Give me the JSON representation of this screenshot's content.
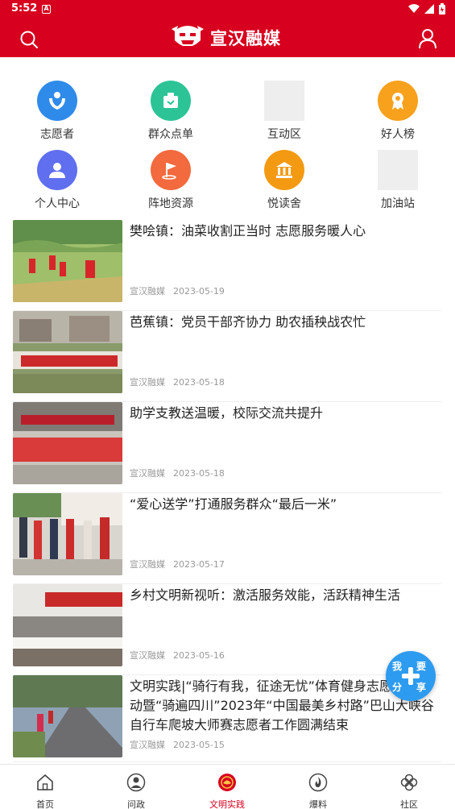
{
  "status": {
    "time": "5:52",
    "notif_glyph": "A"
  },
  "header": {
    "title": "宣汉融媒",
    "accent": "#d8001f"
  },
  "grid": [
    {
      "label": "志愿者",
      "icon": "volunteer-icon",
      "color": "#2f8bea"
    },
    {
      "label": "群众点单",
      "icon": "order-icon",
      "color": "#2cc497"
    },
    {
      "label": "互动区",
      "icon": "image-placeholder",
      "color": ""
    },
    {
      "label": "好人榜",
      "icon": "award-icon",
      "color": "#f7a11c"
    },
    {
      "label": "个人中心",
      "icon": "user-center-icon",
      "color": "#5f6ff0"
    },
    {
      "label": "阵地资源",
      "icon": "location-flag-icon",
      "color": "#f26a3d"
    },
    {
      "label": "悦读舍",
      "icon": "library-icon",
      "color": "#f39a12"
    },
    {
      "label": "加油站",
      "icon": "image-placeholder",
      "color": ""
    }
  ],
  "news": [
    {
      "title": "樊哙镇：油菜收割正当时 志愿服务暖人心",
      "source": "宣汉融媒",
      "date": "2023-05-19"
    },
    {
      "title": "芭蕉镇：党员干部齐协力 助农插秧战农忙",
      "source": "宣汉融媒",
      "date": "2023-05-18"
    },
    {
      "title": "助学支教送温暖，校际交流共提升",
      "source": "宣汉融媒",
      "date": "2023-05-18"
    },
    {
      "title": "“爱心送学”打通服务群众“最后一米”",
      "source": "宣汉融媒",
      "date": "2023-05-17"
    },
    {
      "title": "乡村文明新视听：激活服务效能，活跃精神生活",
      "source": "宣汉融媒",
      "date": "2023-05-16"
    },
    {
      "title": "文明实践|“骑行有我，征途无忧”体育健身志愿服务活动暨“骑遍四川”2023年“中国最美乡村路”巴山大峡谷自行车爬坡大师赛志愿者工作圆满结束",
      "source": "宣汉融媒",
      "date": "2023-05-15"
    }
  ],
  "fab": {
    "c1": "我",
    "c2": "要",
    "c3": "分",
    "c4": "享"
  },
  "nav": [
    {
      "label": "首页",
      "icon": "home-icon"
    },
    {
      "label": "问政",
      "icon": "person-icon"
    },
    {
      "label": "文明实践",
      "icon": "civilization-logo-icon",
      "active": true
    },
    {
      "label": "爆料",
      "icon": "fire-icon"
    },
    {
      "label": "社区",
      "icon": "community-icon"
    }
  ]
}
